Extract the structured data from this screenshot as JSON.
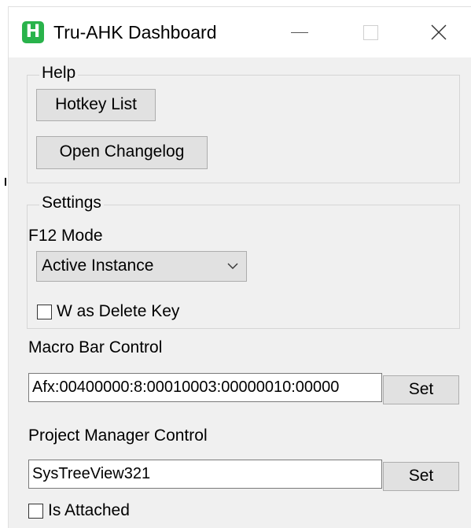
{
  "window": {
    "title": "Tru-AHK Dashboard",
    "icon_letter": "H",
    "accent_color": "#29b34b",
    "controls": {
      "minimize": "minimize-icon",
      "maximize": "maximize-icon",
      "close": "close-icon"
    }
  },
  "help": {
    "title": "Help",
    "hotkey_list_label": "Hotkey List",
    "open_changelog_label": "Open Changelog"
  },
  "settings": {
    "title": "Settings",
    "f12_mode_label": "F12 Mode",
    "f12_mode_selected": "Active Instance",
    "w_delete_label": "W as Delete Key",
    "w_delete_checked": false
  },
  "macro_bar": {
    "label": "Macro Bar Control",
    "value": "Afx:00400000:8:00010003:00000010:00000",
    "set_label": "Set"
  },
  "project_manager": {
    "label": "Project Manager Control",
    "value": "SysTreeView321",
    "set_label": "Set"
  },
  "attached": {
    "label": "Is Attached",
    "checked": false
  }
}
